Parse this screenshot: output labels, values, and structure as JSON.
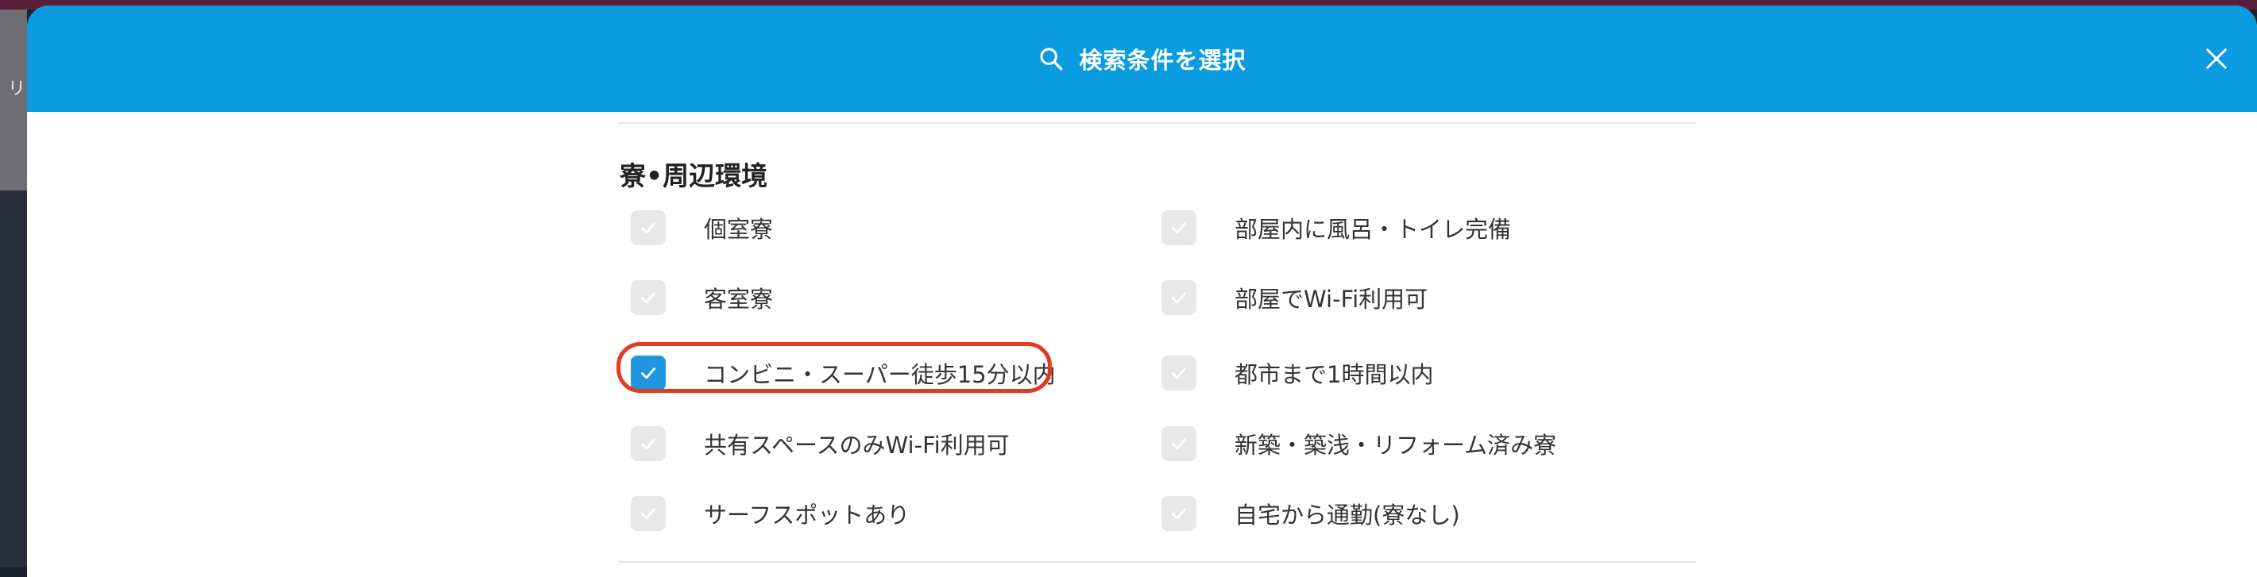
{
  "background": {
    "left_text": "リ"
  },
  "header": {
    "title": "検索条件を選択"
  },
  "section": {
    "title": "寮•周辺環境",
    "left_options": [
      {
        "label": "個室寮",
        "checked": false
      },
      {
        "label": "客室寮",
        "checked": false
      },
      {
        "label": "コンビニ・スーパー徒歩15分以内",
        "checked": true
      },
      {
        "label": "共有スペースのみWi-Fi利用可",
        "checked": false
      },
      {
        "label": "サーフスポットあり",
        "checked": false
      }
    ],
    "right_options": [
      {
        "label": "部屋内に風呂・トイレ完備",
        "checked": false
      },
      {
        "label": "部屋でWi-Fi利用可",
        "checked": false
      },
      {
        "label": "都市まで1時間以内",
        "checked": false
      },
      {
        "label": "新築・築浅・リフォーム済み寮",
        "checked": false
      },
      {
        "label": "自宅から通勤(寮なし)",
        "checked": false
      }
    ]
  },
  "colors": {
    "header": "#0a9be0",
    "checkbox_checked": "#1f97e0",
    "checkbox_unchecked": "#e8e8e8",
    "highlight": "#e23a1f"
  }
}
